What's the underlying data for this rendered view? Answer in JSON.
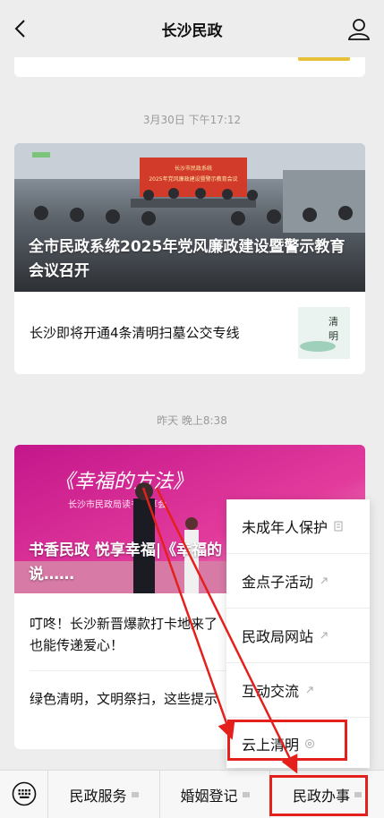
{
  "header": {
    "title": "长沙民政"
  },
  "feed": {
    "group1": {
      "time": "3月30日 下午17:12",
      "cover_title": "全市民政系统2025年党风廉政建设暨警示教育会议召开",
      "cover_banner_line1": "长沙市民政系统",
      "cover_banner_line2": "2025年党风廉政建设暨警示教育会议",
      "item": "长沙即将开通4条清明扫墓公交专线",
      "thumb_chars": [
        "清",
        "明"
      ]
    },
    "group2": {
      "time": "昨天 晚上8:38",
      "cover_title": "书香民政 悦享幸福|《幸福的方法》读书分享会分享……说……",
      "cover_title_visible": "书香民政 悦享幸福|《幸福的",
      "cover_title_line2": "说……",
      "cover_banner": "《幸福的方法》",
      "cover_sub": "长沙市民政局读书分享会",
      "item1_line1": "叮咚！长沙新晋爆款打卡地来了",
      "item1_line2": "也能传递爱心！",
      "item2": "绿色清明，文明祭扫，这些提示"
    }
  },
  "popup_menu": {
    "items": [
      {
        "label": "未成年人保护",
        "icon": "article-icon"
      },
      {
        "label": "金点子活动",
        "icon": "link-icon"
      },
      {
        "label": "民政局网站",
        "icon": "link-icon"
      },
      {
        "label": "互动交流",
        "icon": "link-icon"
      },
      {
        "label": "云上清明",
        "icon": "mini-program-icon"
      }
    ]
  },
  "bottom_bar": {
    "tabs": [
      "民政服务",
      "婚姻登记",
      "民政办事"
    ]
  },
  "colors": {
    "background": "#ededed",
    "annotation_red": "#e4201c",
    "accent_yellow": "#e7c03a"
  }
}
